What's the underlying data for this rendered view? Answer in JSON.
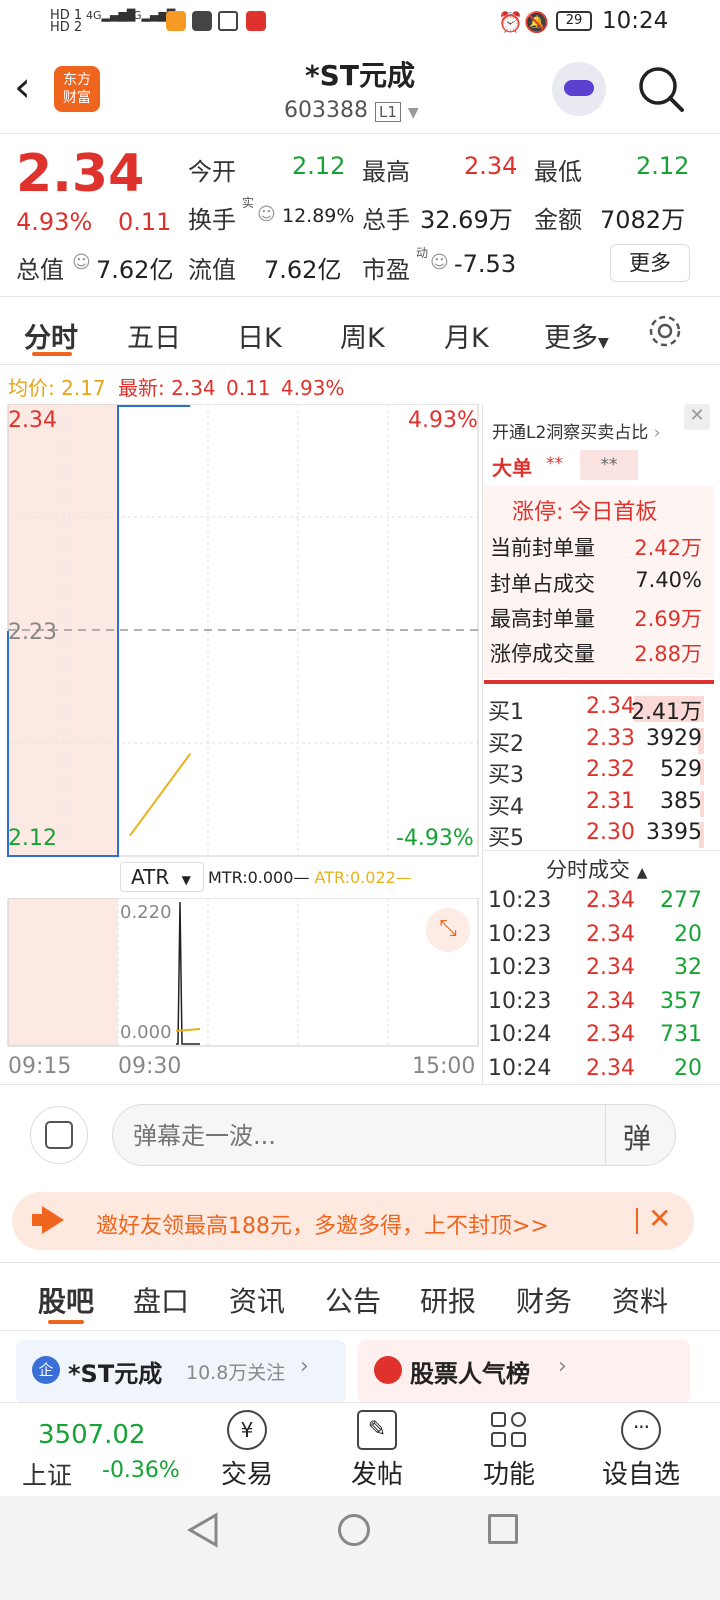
{
  "status_bar": {
    "time": "10:24",
    "battery": "29",
    "hd1": "HD 1",
    "hd2": "HD 2",
    "net1": "4G",
    "net2": "4G"
  },
  "header": {
    "title": "*ST元成",
    "code": "603388",
    "level": "L1",
    "logo_line1": "东方",
    "logo_line2": "财富"
  },
  "quote": {
    "price": "2.34",
    "change_pct": "4.93%",
    "change": "0.11",
    "open_label": "今开",
    "open": "2.12",
    "high_label": "最高",
    "high": "2.34",
    "low_label": "最低",
    "low": "2.12",
    "turnover_label": "换手",
    "turnover_sup": "实",
    "turnover": "12.89%",
    "volume_label": "总手",
    "volume": "32.69万",
    "amount_label": "金额",
    "amount": "7082万",
    "mktcap_label": "总值",
    "mktcap": "7.62亿",
    "float_label": "流值",
    "float": "7.62亿",
    "pe_label": "市盈",
    "pe_sup": "动",
    "pe": "-7.53",
    "more_button": "更多"
  },
  "tabs": [
    "分时",
    "五日",
    "日K",
    "周K",
    "月K",
    "更多"
  ],
  "info_line": {
    "avg_label": "均价:",
    "avg": "2.17",
    "latest_label": "最新:",
    "latest": "2.34",
    "chg": "0.11",
    "pct": "4.93%"
  },
  "chart": {
    "y_top": "2.34",
    "y_mid": "2.23",
    "y_bottom": "2.12",
    "pct_top": "4.93%",
    "pct_bottom": "-4.93%",
    "indicator": "ATR",
    "mtr_label": "MTR:0.000",
    "atr_label": "ATR:0.022",
    "sub_top": "0.220",
    "sub_bottom": "0.000",
    "times": [
      "09:15",
      "09:30",
      "15:00"
    ]
  },
  "chart_data": {
    "type": "line",
    "series": [
      {
        "name": "",
        "x": [
          "09:15",
          "09:25",
          "09:30",
          "09:31",
          "09:32",
          "10:24"
        ],
        "values": [
          2.23,
          2.12,
          2.12,
          2.34,
          2.34,
          2.34
        ]
      },
      {
        "name": "",
        "x": [
          "09:31",
          "10:24"
        ],
        "values": [
          2.13,
          2.17
        ]
      }
    ],
    "ylim": [
      2.12,
      2.34
    ]
  },
  "right_panel": {
    "l2_link": "开通L2洞察买卖占比",
    "big_order_label": "大单",
    "big_order_val1": "**",
    "big_order_val2": "**",
    "limit_label": "涨停:",
    "limit_text": "今日首板",
    "stats": [
      {
        "label": "当前封单量",
        "value": "2.42万"
      },
      {
        "label": "封单占成交",
        "value": "7.40%"
      },
      {
        "label": "最高封单量",
        "value": "2.69万"
      },
      {
        "label": "涨停成交量",
        "value": "2.88万"
      }
    ],
    "bids": [
      {
        "label": "买1",
        "price": "2.34",
        "vol": "2.41万",
        "bar": 0.9
      },
      {
        "label": "买2",
        "price": "2.33",
        "vol": "3929",
        "bar": 0.08
      },
      {
        "label": "买3",
        "price": "2.32",
        "vol": "529",
        "bar": 0.02
      },
      {
        "label": "买4",
        "price": "2.31",
        "vol": "385",
        "bar": 0.02
      },
      {
        "label": "买5",
        "price": "2.30",
        "vol": "3395",
        "bar": 0.07
      }
    ],
    "trades_title": "分时成交",
    "trades": [
      {
        "time": "10:23",
        "price": "2.34",
        "vol": "277"
      },
      {
        "time": "10:23",
        "price": "2.34",
        "vol": "20"
      },
      {
        "time": "10:23",
        "price": "2.34",
        "vol": "32"
      },
      {
        "time": "10:23",
        "price": "2.34",
        "vol": "357"
      },
      {
        "time": "10:24",
        "price": "2.34",
        "vol": "731"
      },
      {
        "time": "10:24",
        "price": "2.34",
        "vol": "20"
      }
    ]
  },
  "danmu": {
    "placeholder": "弹幕走一波...",
    "button": "弹"
  },
  "promo": {
    "text": "邀好友领最高188元，多邀多得，上不封顶>>"
  },
  "bottom_tabs": [
    "股吧",
    "盘口",
    "资讯",
    "公告",
    "研报",
    "财务",
    "资料"
  ],
  "cards": {
    "stock_name": "*ST元成",
    "followers": "10.8万关注",
    "popularity": "股票人气榜"
  },
  "index_bar": {
    "value": "3507.02",
    "name": "上证",
    "change": "-0.36%"
  },
  "nav": [
    "交易",
    "发帖",
    "功能",
    "设自选"
  ],
  "colors": {
    "red": "#e0322d",
    "green": "#16a234",
    "blue": "#2b6fd1",
    "orange": "#f0651e",
    "avg_line": "#e8b21a"
  }
}
